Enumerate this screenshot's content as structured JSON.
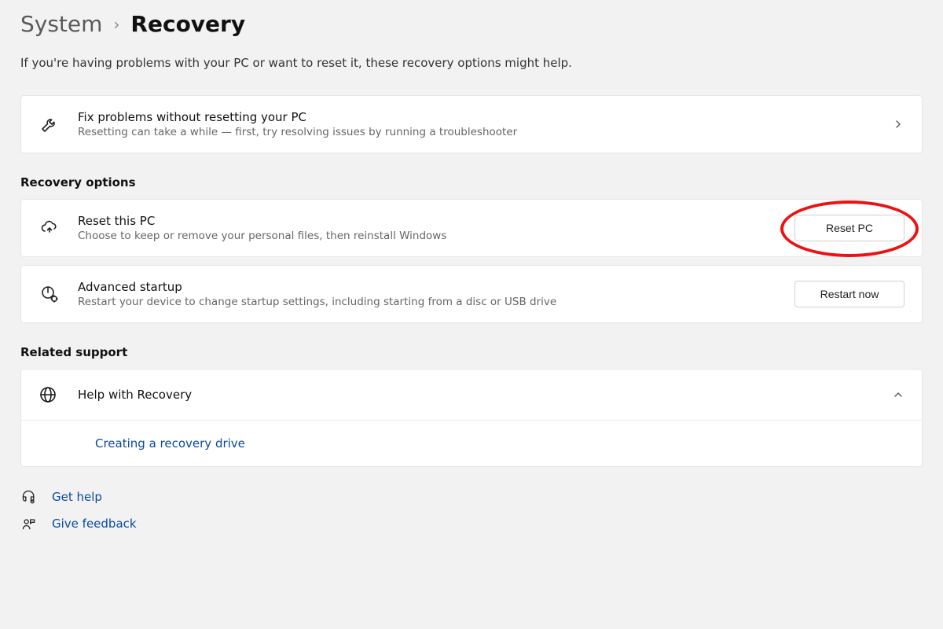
{
  "breadcrumb": {
    "parent": "System",
    "sep": "›",
    "current": "Recovery"
  },
  "intro": "If you're having problems with your PC or want to reset it, these recovery options might help.",
  "cards": {
    "troubleshoot": {
      "title": "Fix problems without resetting your PC",
      "sub": "Resetting can take a while — first, try resolving issues by running a troubleshooter"
    },
    "reset": {
      "title": "Reset this PC",
      "sub": "Choose to keep or remove your personal files, then reinstall Windows",
      "button": "Reset PC"
    },
    "advanced": {
      "title": "Advanced startup",
      "sub": "Restart your device to change startup settings, including starting from a disc or USB drive",
      "button": "Restart now"
    }
  },
  "sections": {
    "recovery_options": "Recovery options",
    "related_support": "Related support"
  },
  "help_panel": {
    "title": "Help with Recovery",
    "links": {
      "create_recovery_drive": "Creating a recovery drive"
    }
  },
  "footer": {
    "get_help": "Get help",
    "give_feedback": "Give feedback"
  }
}
